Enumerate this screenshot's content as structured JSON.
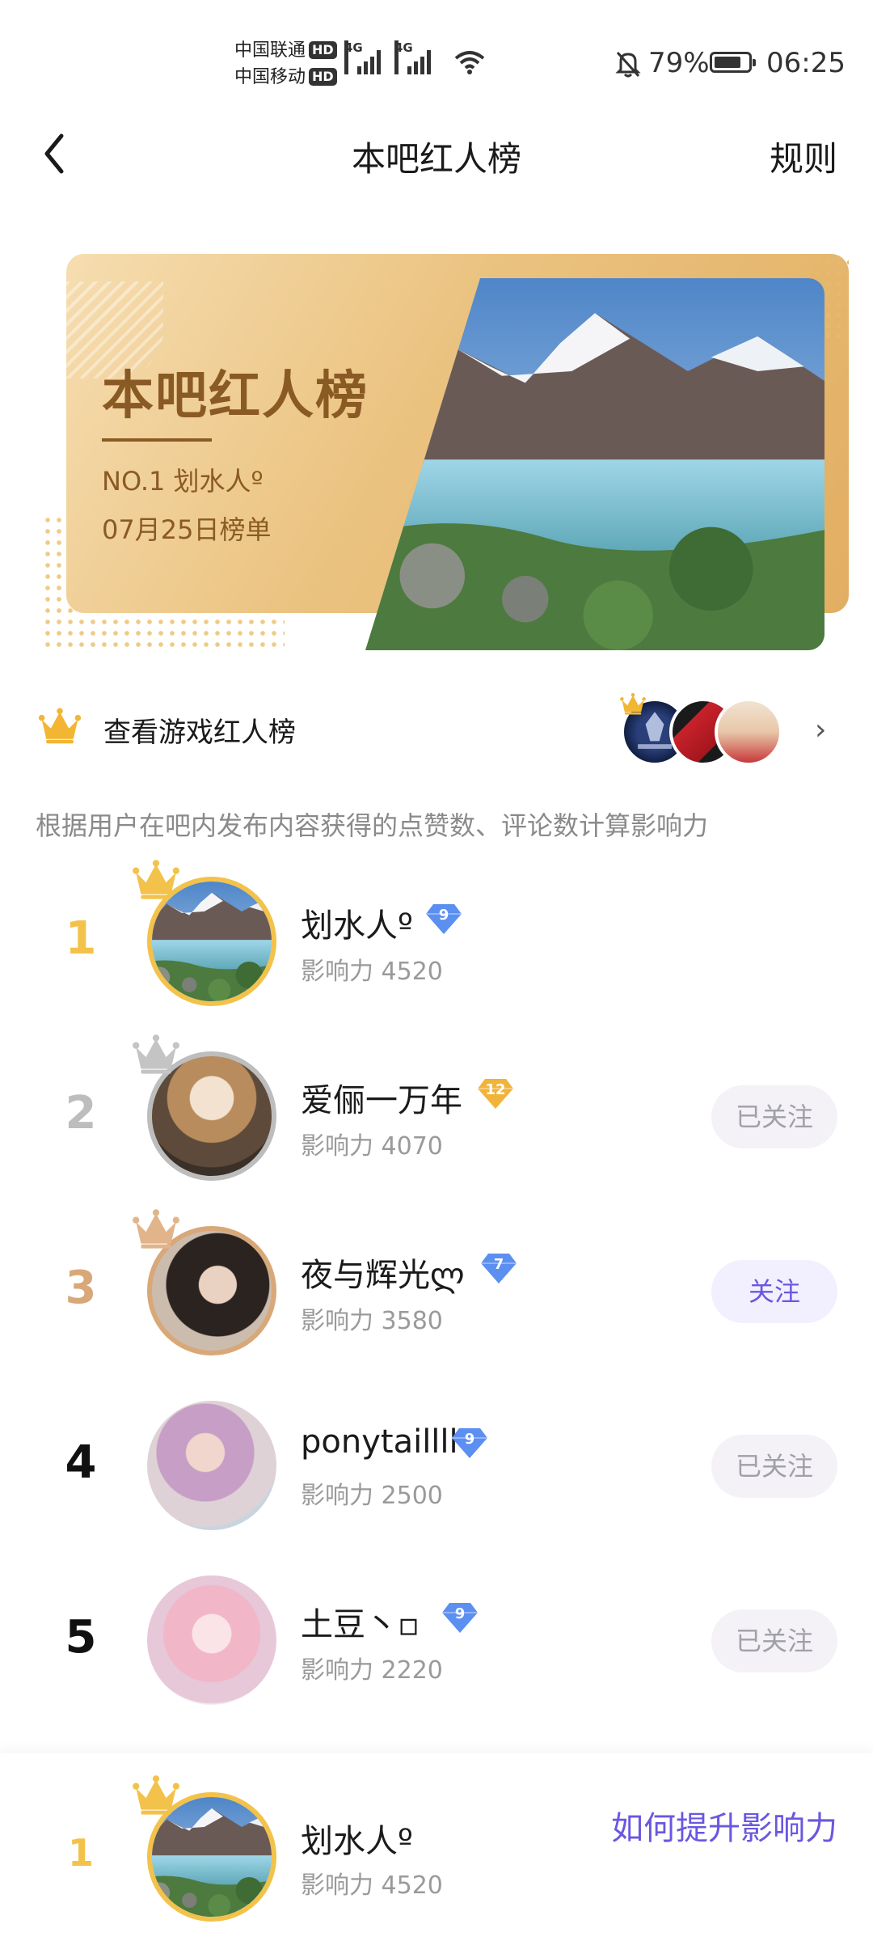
{
  "status_bar": {
    "carrier1": "中国联通",
    "carrier2": "中国移动",
    "hd": "HD",
    "net": "4G",
    "battery": "79%",
    "battery_level": 0.79,
    "time": "06:25"
  },
  "nav": {
    "title": "本吧红人榜",
    "rules": "规则"
  },
  "banner": {
    "title": "本吧红人榜",
    "no1": "NO.1  划水人º",
    "date": "07月25日榜单"
  },
  "game_row": {
    "label": "查看游戏红人榜"
  },
  "description": "根据用户在吧内发布内容获得的点赞数、评论数计算影响力",
  "colors": {
    "gold": "#f3c24a",
    "silver": "#b9b9b9",
    "bronze": "#d8a879",
    "accent": "#6a57e0",
    "level_blue": "#5b8ff2",
    "level_gold": "#f2b33a"
  },
  "ranking": [
    {
      "rank": "1",
      "name": "划水人º",
      "level": "9",
      "influence": "影响力  4520",
      "follow": ""
    },
    {
      "rank": "2",
      "name": "爱俪一万年",
      "level": "12",
      "influence": "影响力  4070",
      "follow": "已关注"
    },
    {
      "rank": "3",
      "name": "夜与辉光ლ",
      "level": "7",
      "influence": "影响力  3580",
      "follow": "关注"
    },
    {
      "rank": "4",
      "name": "ponytaillll",
      "level": "9",
      "influence": "影响力  2500",
      "follow": "已关注"
    },
    {
      "rank": "5",
      "name": "土豆丶▫",
      "level": "9",
      "influence": "影响力  2220",
      "follow": "已关注"
    }
  ],
  "me": {
    "rank": "1",
    "name": "划水人º",
    "influence": "影响力  4520",
    "how": "如何提升影响力"
  }
}
